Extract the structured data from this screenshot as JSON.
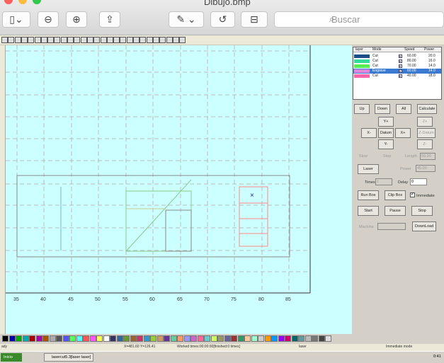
{
  "window": {
    "title": "Dibujo.bmp",
    "search_placeholder": "Buscar"
  },
  "canvas": {
    "x_ticks": [
      "35",
      "40",
      "45",
      "50",
      "55",
      "60",
      "65",
      "70",
      "75",
      "80",
      "85"
    ]
  },
  "layers": {
    "headers": [
      "layer",
      "Mode",
      "Speed",
      "Power"
    ],
    "rows": [
      {
        "mode": "Cut",
        "speed": "60.00",
        "power": "20.0",
        "color": "#1b4f8a"
      },
      {
        "mode": "Cut",
        "speed": "80.00",
        "power": "16.0",
        "color": "#33dd99"
      },
      {
        "mode": "Cut",
        "speed": "70.00",
        "power": "14.0",
        "color": "#55ee55"
      },
      {
        "mode": "Engrave",
        "speed": "60.00",
        "power": "14.0",
        "color": "#dd88dd"
      },
      {
        "mode": "Cut",
        "speed": "40.00",
        "power": "18.0",
        "color": "#ff66aa"
      }
    ]
  },
  "controls": {
    "up": "Up",
    "down": "Down",
    "all": "All",
    "calculate": "Calculate",
    "y_plus": "Y+",
    "x_minus": "X-",
    "datum": "Datum",
    "x_plus": "X+",
    "y_minus": "Y-",
    "z_plus": "Z+",
    "z_datum": "Z-Datum",
    "z_minus": "Z-",
    "slow": "Slow",
    "step": "Step",
    "length_label": "Length",
    "length_value": "50.00",
    "laser": "Laser",
    "power_label": "Power",
    "power_value": "45.00",
    "times_label": "Times",
    "times_value": "1",
    "delay_label": "Delay",
    "delay_value": "0",
    "run_box": "Run Box",
    "clip_box": "Clip Box",
    "immediate": "Immediate",
    "start": "Start",
    "pause": "Pause",
    "stop": "Stop",
    "machine_label": "Machine",
    "download": "DownLoad"
  },
  "status": {
    "ready": "ady",
    "coords": "X=481.60 Y=126.41",
    "worked": "Worked times:00:00:00[finished:0 times]",
    "laser": "laser",
    "mode": "Immediate mode"
  },
  "taskbar": {
    "start": "Inicio",
    "app": "lasercut5.3[laser laser]",
    "clock": "0:41"
  },
  "palette_colors": [
    "#000000",
    "#0000aa",
    "#00aa00",
    "#00aaaa",
    "#aa0000",
    "#aa00aa",
    "#aa5500",
    "#aaaaaa",
    "#555555",
    "#5555ff",
    "#55ff55",
    "#55ffff",
    "#ff5555",
    "#ff55ff",
    "#ffff55",
    "#ffffff",
    "#333366",
    "#336699",
    "#669933",
    "#996633",
    "#cc3366",
    "#3399cc",
    "#99cc33",
    "#cc9966",
    "#663399",
    "#66cc99",
    "#ff9966",
    "#9999ff",
    "#cc66cc",
    "#ff6699",
    "#66cccc",
    "#ccff66",
    "#999966",
    "#666699",
    "#993333",
    "#339966",
    "#ffcc99",
    "#99ffcc",
    "#cccccc",
    "#ff9900",
    "#0099ff",
    "#9900ff",
    "#cc0066",
    "#006666",
    "#669999",
    "#bbbbbb",
    "#777777",
    "#444444",
    "#dddddd"
  ]
}
